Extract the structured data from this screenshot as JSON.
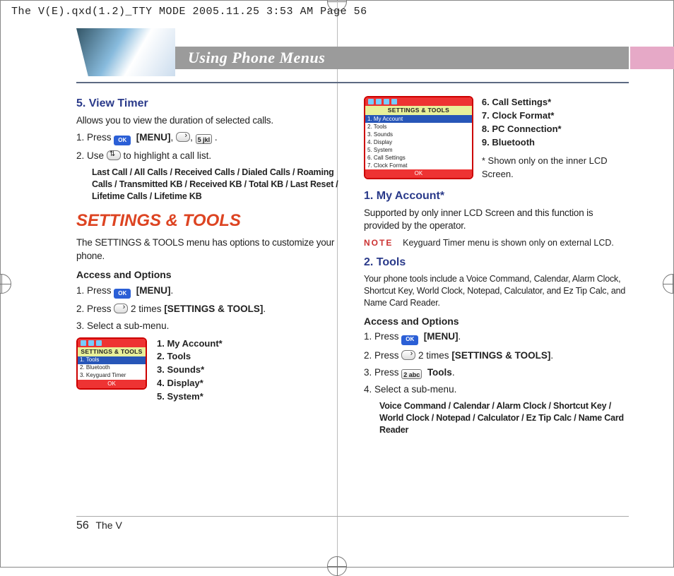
{
  "tty_header": "The V(E).qxd(1.2)_TTY MODE  2005.11.25  3:53 AM  Page 56",
  "banner_title": "Using Phone Menus",
  "left": {
    "h_view_timer": "5. View Timer",
    "view_desc": "Allows you to view the duration of selected calls.",
    "vt_step1_a": "1.  Press ",
    "vt_step1_b": "[MENU]",
    "vt_step1_c": ", ",
    "vt_step1_d": ", ",
    "vt_step1_key5": "5 jkl",
    "vt_step1_e": " .",
    "vt_step2_a": "2.  Use ",
    "vt_step2_b": " to highlight a call list.",
    "vt_list": "Last Call / All Calls / Received Calls / Dialed Calls / Roaming Calls / Transmitted KB / Received KB / Total KB / Last Reset  / Lifetime Calls / Lifetime KB",
    "h_settings": "SETTINGS & TOOLS",
    "settings_intro": "The SETTINGS & TOOLS menu has options to customize your phone.",
    "h_access": "Access and Options",
    "st_step1_a": "1.  Press ",
    "st_step1_b": "[MENU]",
    "st_step1_c": ".",
    "st_step2_a": "2.  Press ",
    "st_step2_b": " 2 times  ",
    "st_step2_c": "[SETTINGS & TOOLS]",
    "st_step2_d": ".",
    "st_step3": "3.  Select a sub-menu.",
    "screen_sm_title": "SETTINGS & TOOLS",
    "screen_sm_items": [
      "1. Tools",
      "2. Bluetooth",
      "3. Keyguard Timer"
    ],
    "menu15": [
      "1. My Account*",
      "2. Tools",
      "3. Sounds*",
      "4. Display*",
      "5. System*"
    ]
  },
  "right": {
    "screen_lg_title": "SETTINGS & TOOLS",
    "screen_lg_items": [
      "1. My Account",
      "2. Tools",
      "3. Sounds",
      "4. Display",
      "5. System",
      "6. Call Settings",
      "7. Clock Format"
    ],
    "menu69": [
      "6. Call Settings*",
      "7. Clock Format*",
      "8. PC Connection*",
      "9. Bluetooth"
    ],
    "footnote": "*  Shown only on the inner LCD Screen.",
    "h_myacct": "1. My Account*",
    "myacct_desc": "Supported by only inner LCD Screen and this function is provided by the operator.",
    "note_label": "NOTE",
    "note_text": "Keyguard Timer menu is shown only on external LCD.",
    "h_tools": "2. Tools",
    "tools_desc": "Your phone tools include a Voice Command, Calendar, Alarm Clock, Shortcut Key, World Clock, Notepad, Calculator, and Ez Tip Calc, and Name Card Reader.",
    "h_access": "Access and Options",
    "t_step1_a": "1.  Press ",
    "t_step1_b": "[MENU]",
    "t_step1_c": ".",
    "t_step2_a": "2.  Press ",
    "t_step2_b": " 2 times ",
    "t_step2_c": "[SETTINGS & TOOLS]",
    "t_step2_d": ".",
    "t_step3_a": "3.  Press ",
    "t_step3_key": "2 abc",
    "t_step3_b": "Tools",
    "t_step3_c": ".",
    "t_step4": "4.   Select a sub-menu.",
    "t_sublist": "Voice Command / Calendar / Alarm Clock / Shortcut Key / World Clock / Notepad / Calculator / Ez Tip Calc /  Name Card Reader"
  },
  "footer": {
    "page": "56",
    "title": "The V"
  },
  "ok_label": "OK"
}
